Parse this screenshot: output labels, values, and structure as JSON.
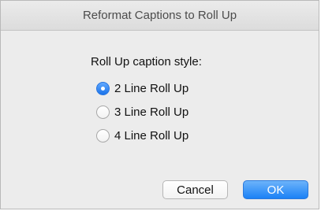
{
  "dialog": {
    "title": "Reformat Captions to Roll Up",
    "prompt": "Roll Up caption style:",
    "options": [
      {
        "label": "2 Line Roll Up",
        "selected": true
      },
      {
        "label": "3 Line Roll Up",
        "selected": false
      },
      {
        "label": "4 Line Roll Up",
        "selected": false
      }
    ],
    "buttons": {
      "cancel_label": "Cancel",
      "ok_label": "OK"
    }
  },
  "colors": {
    "accent": "#1b81f6",
    "window_background": "#ececec"
  }
}
